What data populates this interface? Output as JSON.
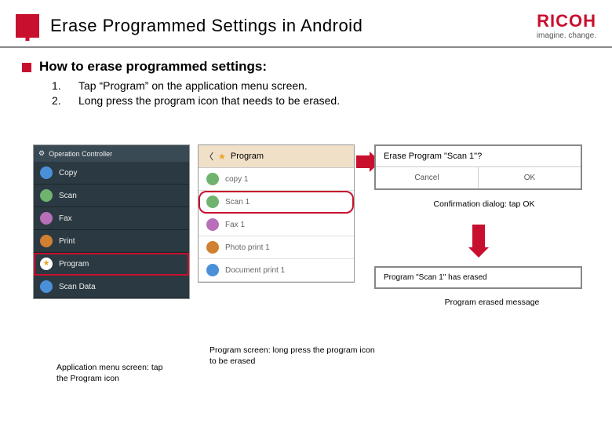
{
  "header": {
    "title": "Erase Programmed Settings in Android",
    "logo_text": "RICOH",
    "logo_sub": "imagine. change."
  },
  "intro": "How to erase programmed settings:",
  "steps": [
    {
      "num": "1.",
      "text": "Tap “Program” on the application menu screen."
    },
    {
      "num": "2.",
      "text": "Long press the program icon that needs to be erased."
    }
  ],
  "app_menu": {
    "header": "Operation Controller",
    "items": [
      {
        "label": "Copy",
        "color": "#4a90d9"
      },
      {
        "label": "Scan",
        "color": "#6fb36f"
      },
      {
        "label": "Fax",
        "color": "#b86fb8"
      },
      {
        "label": "Print",
        "color": "#d08030"
      },
      {
        "label": "Program",
        "color": "#f0a020",
        "highlight": true
      },
      {
        "label": "Scan Data",
        "color": "#4a90d9"
      }
    ]
  },
  "program_screen": {
    "header": "Program",
    "items": [
      {
        "label": "copy 1",
        "color": "#6fb36f"
      },
      {
        "label": "Scan 1",
        "color": "#6fb36f",
        "highlight": true
      },
      {
        "label": "Fax 1",
        "color": "#b86fb8"
      },
      {
        "label": "Photo print 1",
        "color": "#d08030"
      },
      {
        "label": "Document print 1",
        "color": "#4a90d9"
      }
    ]
  },
  "dialog": {
    "title": "Erase Program \"Scan 1\"?",
    "cancel": "Cancel",
    "ok": "OK"
  },
  "toast": "Program \"Scan 1\" has erased",
  "captions": {
    "app": "Application menu screen: tap the Program icon",
    "prog": "Program screen: long press the program icon to be erased",
    "dialog": "Confirmation dialog: tap OK",
    "toast": "Program erased message"
  }
}
